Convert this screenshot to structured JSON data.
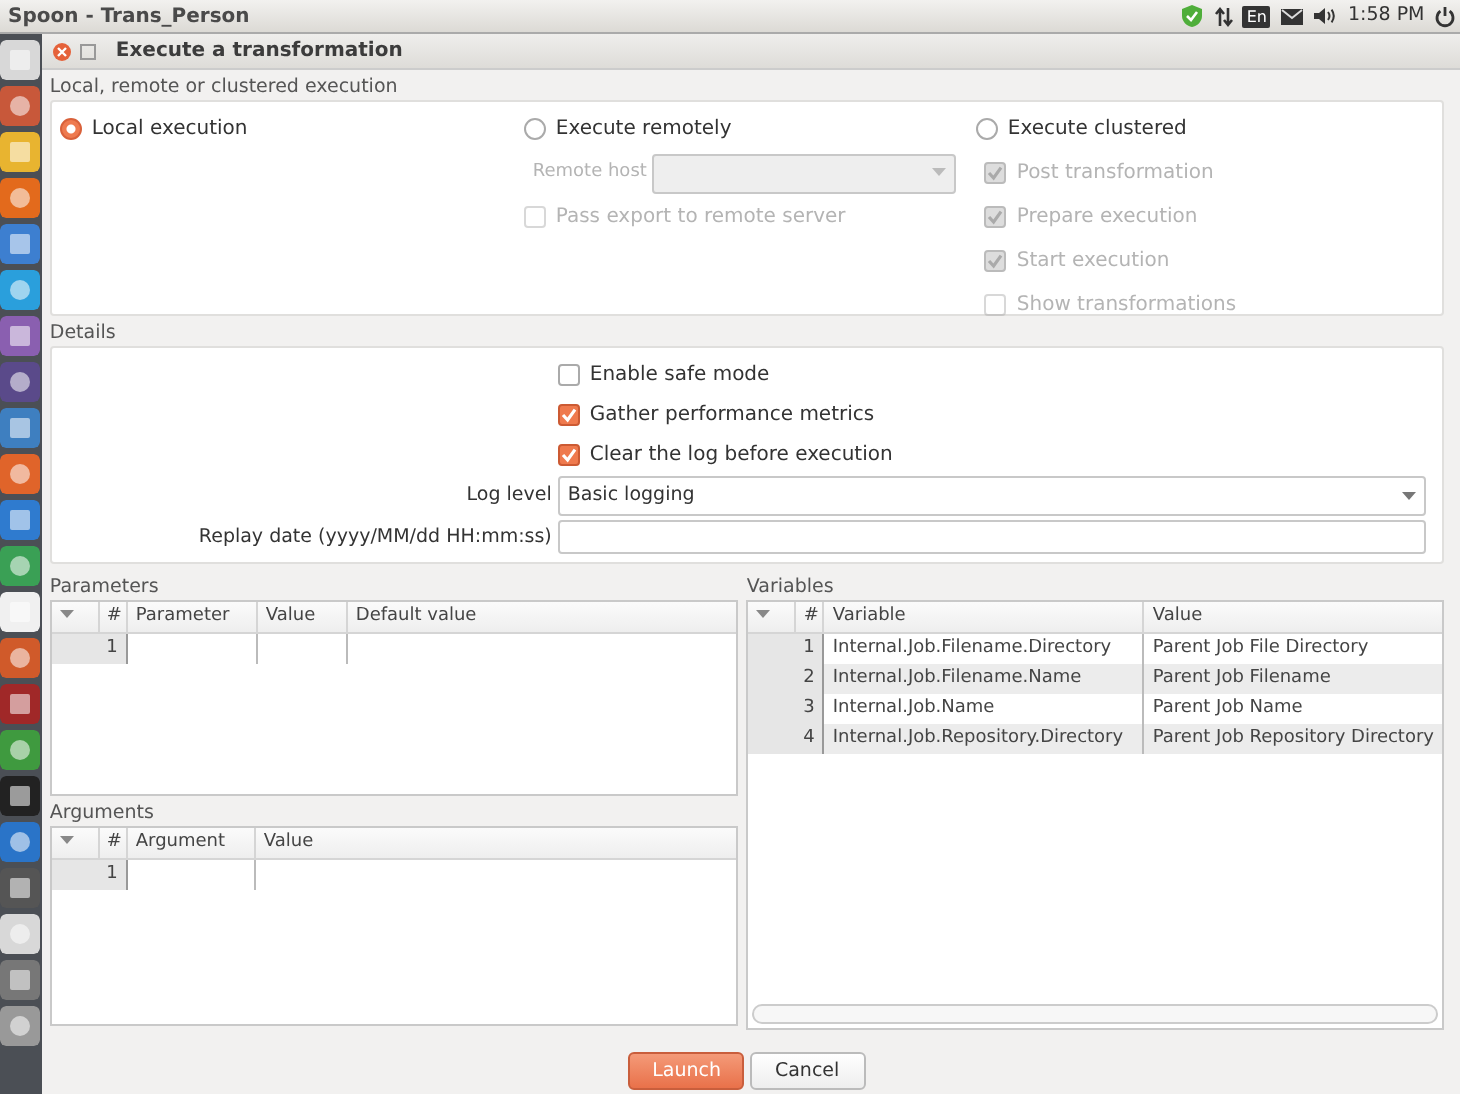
{
  "top_bar": {
    "title": "Spoon - Trans_Person",
    "keyboard_layout": "En",
    "time": "1:58 PM"
  },
  "dialog": {
    "title": "Execute a transformation",
    "execution": {
      "legend": "Local, remote or clustered execution",
      "options": [
        {
          "label": "Local execution",
          "selected": true
        },
        {
          "label": "Execute remotely",
          "selected": false
        },
        {
          "label": "Execute clustered",
          "selected": false
        }
      ],
      "remote_host_label": "Remote host",
      "pass_export": {
        "label": "Pass export to remote server",
        "checked": false,
        "disabled": true
      },
      "clustered_options": [
        {
          "label": "Post transformation",
          "checked": true,
          "disabled": true
        },
        {
          "label": "Prepare execution",
          "checked": true,
          "disabled": true
        },
        {
          "label": "Start execution",
          "checked": true,
          "disabled": true
        },
        {
          "label": "Show transformations",
          "checked": false,
          "disabled": true
        }
      ]
    },
    "details": {
      "legend": "Details",
      "checkboxes": [
        {
          "label": "Enable safe mode",
          "checked": false
        },
        {
          "label": "Gather performance metrics",
          "checked": true
        },
        {
          "label": "Clear the log before execution",
          "checked": true
        }
      ],
      "log_level_label": "Log level",
      "log_level": "Basic logging",
      "replay_date_label": "Replay date (yyyy/MM/dd HH:mm:ss)"
    },
    "parameters": {
      "title": "Parameters",
      "columns": [
        "#",
        "Parameter",
        "Value",
        "Default value"
      ],
      "rows": [
        {
          "number": "1",
          "selected": false
        }
      ]
    },
    "arguments": {
      "title": "Arguments",
      "columns": [
        "#",
        "Argument",
        "Value"
      ],
      "rows": [
        {
          "number": "1",
          "selected": false
        }
      ]
    },
    "variables": {
      "title": "Variables",
      "columns": [
        "#",
        "Variable",
        "Value"
      ],
      "rows": [
        {
          "number": "1",
          "variable": "Internal.Job.Filename.Directory",
          "value": "Parent Job File Directory",
          "selected": false
        },
        {
          "number": "2",
          "variable": "Internal.Job.Filename.Name",
          "value": "Parent Job Filename",
          "selected": true
        },
        {
          "number": "3",
          "variable": "Internal.Job.Name",
          "value": "Parent Job Name",
          "selected": false
        },
        {
          "number": "4",
          "variable": "Internal.Job.Repository.Directory",
          "value": "Parent Job Repository Directory",
          "selected": true
        }
      ]
    },
    "buttons": [
      {
        "label": "Launch",
        "kind": "primary"
      },
      {
        "label": "Cancel",
        "kind": "secondary"
      }
    ]
  }
}
